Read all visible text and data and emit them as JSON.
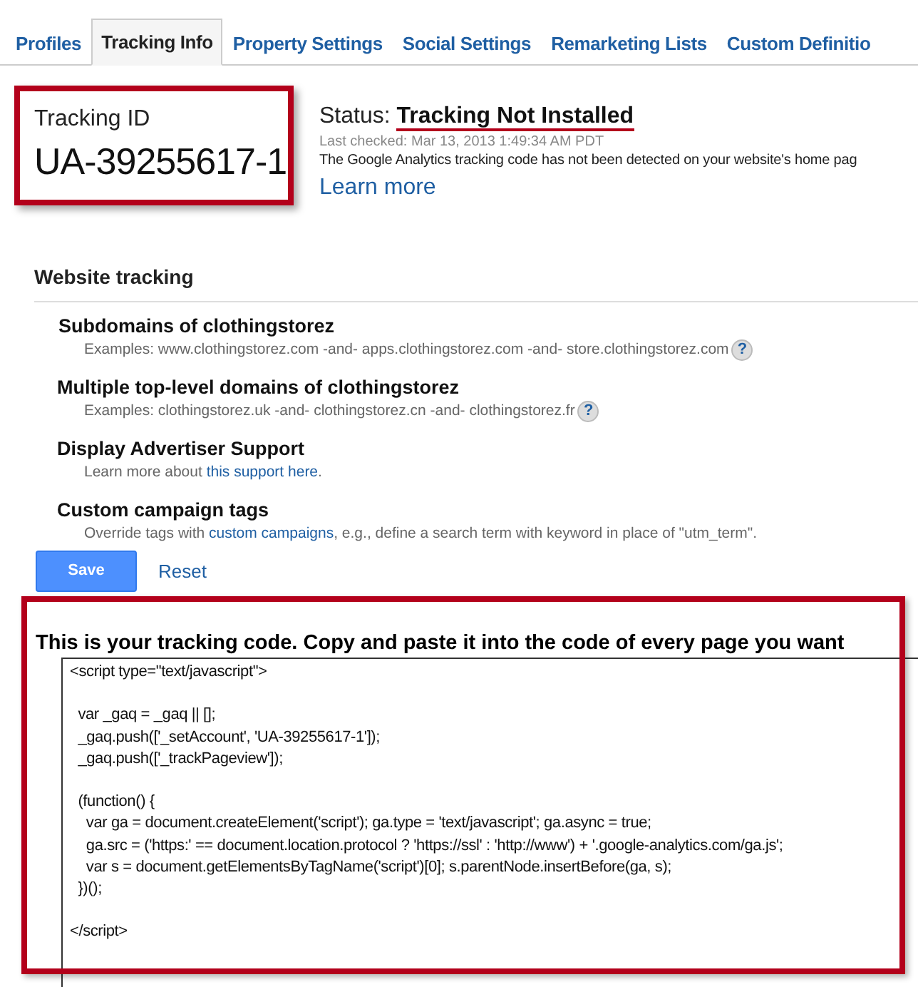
{
  "tabs": [
    {
      "label": "Profiles",
      "selected": false
    },
    {
      "label": "Tracking Info",
      "selected": true
    },
    {
      "label": "Property Settings",
      "selected": false
    },
    {
      "label": "Social Settings",
      "selected": false
    },
    {
      "label": "Remarketing Lists",
      "selected": false
    },
    {
      "label": "Custom Definitio",
      "selected": false
    }
  ],
  "tracking_id": {
    "label": "Tracking ID",
    "value": "UA-39255617-1"
  },
  "status": {
    "label": "Status:",
    "value": "Tracking Not Installed",
    "last_checked": "Last checked: Mar 13, 2013 1:49:34 AM PDT",
    "message": "The Google Analytics tracking code has not been detected on your website's home pag",
    "link": "Learn more"
  },
  "website_tracking": {
    "title": "Website tracking",
    "options": [
      {
        "title": "Subdomains of clothingstorez",
        "desc": "Examples: www.clothingstorez.com -and- apps.clothingstorez.com -and- store.clothingstorez.com",
        "help": "?"
      },
      {
        "title": "Multiple top-level domains of clothingstorez",
        "desc": "Examples: clothingstorez.uk -and- clothingstorez.cn -and- clothingstorez.fr",
        "help": "?"
      },
      {
        "title": "Display Advertiser Support",
        "desc": "Learn more about ",
        "link": "this support here",
        "desc_after": "."
      },
      {
        "title": "Custom campaign tags",
        "desc": "Override tags with ",
        "link": "custom campaigns",
        "desc_after": ", e.g., define a search term with keyword in place of \"utm_term\"."
      }
    ],
    "buttons": [
      {
        "label": "Save",
        "kind": "primary"
      },
      {
        "label": "Reset",
        "kind": "link"
      }
    ]
  },
  "tracking_code": {
    "heading": "This is your tracking code. Copy and paste it into the code of every page you want",
    "blocks": [
      [
        "<script type=\"text/javascript\">"
      ],
      [
        "  var _gaq = _gaq || [];",
        "  _gaq.push(['_setAccount', 'UA-39255617-1']);",
        "  _gaq.push(['_trackPageview']);"
      ],
      [
        "  (function() {",
        "    var ga = document.createElement('script'); ga.type = 'text/javascript'; ga.async = true;",
        "    ga.src = ('https:' == document.location.protocol ? 'https://ssl' : 'http://www') + '.google-analytics.com/ga.js';",
        "    var s = document.getElementsByTagName('script')[0]; s.parentNode.insertBefore(ga, s);",
        "  })();"
      ],
      [
        "</script>"
      ]
    ]
  }
}
